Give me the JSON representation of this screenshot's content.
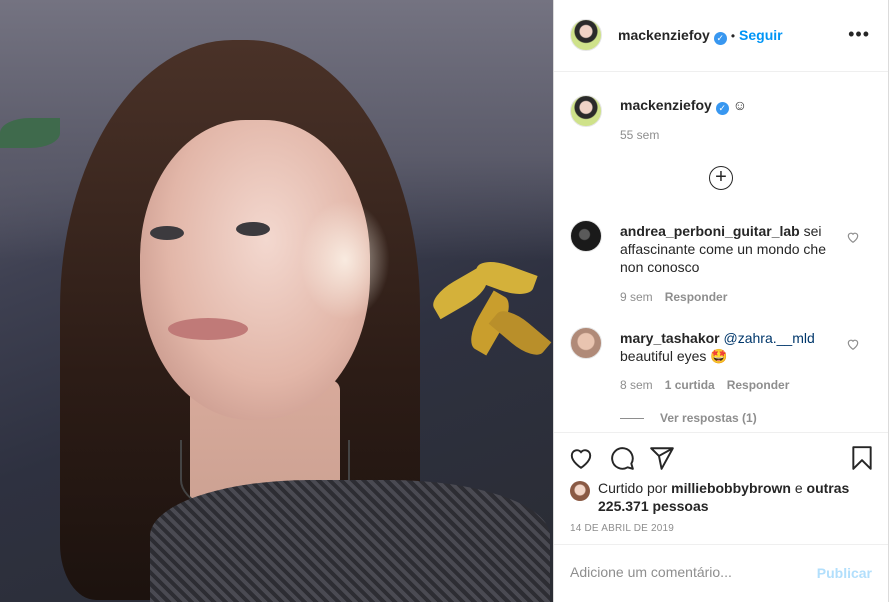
{
  "post": {
    "author": "mackenziefoy",
    "follow_label": "Seguir",
    "separator": "•",
    "verified_symbol": "✓",
    "more_label": "•••",
    "caption_text": "☺",
    "caption_time": "55 sem",
    "load_more_label": "+"
  },
  "comments": [
    {
      "user": "andrea_perboni_guitar_lab",
      "text": "sei affascinante come un mondo che non conosco",
      "time": "9 sem",
      "reply_label": "Responder"
    },
    {
      "user": "mary_tashakor",
      "mention": "@zahra.__mld",
      "text": "beautiful eyes 🤩",
      "time": "8 sem",
      "likes": "1 curtida",
      "reply_label": "Responder",
      "view_replies": "Ver respostas (1)"
    }
  ],
  "engagement": {
    "liked_prefix": "Curtido por",
    "liked_user": "milliebobbybrown",
    "liked_middle": "e",
    "liked_count": "outras 225.371 pessoas",
    "date": "14 DE ABRIL DE 2019"
  },
  "comment_box": {
    "placeholder": "Adicione um comentário...",
    "post_label": "Publicar"
  },
  "icons": [
    "heart-icon",
    "comment-icon",
    "share-icon",
    "bookmark-icon",
    "verified-icon",
    "more-options-icon",
    "plus-circle-icon"
  ],
  "colors": {
    "link_blue": "#0095f6",
    "verified_blue": "#3897f0",
    "muted_text": "#8e8e8e",
    "post_disabled": "#b2dffc"
  }
}
